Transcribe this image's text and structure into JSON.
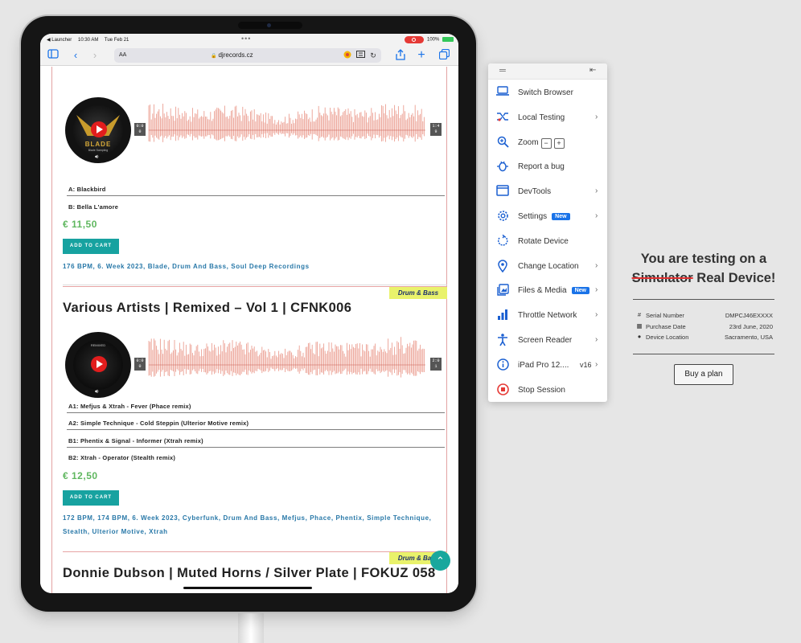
{
  "status_bar": {
    "back_app": "◀ Launcher",
    "time": "10:30 AM",
    "date": "Tue Feb 21",
    "battery": "100%"
  },
  "browser": {
    "text_size": "AA",
    "url": "djrecords.cz"
  },
  "page": {
    "product1": {
      "disc_text": "BLADE",
      "disc_sub": "Blade Sampling",
      "time_start": [
        "0:0",
        "0"
      ],
      "time_end": [
        "1:4",
        "9"
      ],
      "tracks": [
        "A: Blackbird",
        "B: Bella L'amore"
      ],
      "price": "€ 11,50",
      "cart_label": "ADD TO CART",
      "tags": "176 BPM, 6. Week 2023, Blade, Drum And Bass, Soul Deep Recordings"
    },
    "product2": {
      "genre": "Drum & Bass",
      "title": "Various Artists | Remixed – Vol 1 | CFNK006",
      "disc_top": "REMIXED",
      "time_start": [
        "0:0",
        "0"
      ],
      "time_end": [
        "2:0",
        "1"
      ],
      "tracks": [
        "A1: Mefjus & Xtrah - Fever (Phace remix)",
        "A2: Simple Technique - Cold Steppin (Ulterior Motive remix)",
        "B1: Phentix & Signal - Informer (Xtrah remix)",
        "B2: Xtrah - Operator (Stealth remix)"
      ],
      "price": "€ 12,50",
      "cart_label": "ADD TO CART",
      "tags": "172 BPM, 174 BPM, 6. Week 2023, Cyberfunk, Drum And Bass, Mefjus, Phace, Phentix, Simple Technique, Stealth, Ulterior Motive, Xtrah"
    },
    "product3": {
      "genre": "Drum & Bass",
      "title": "Donnie Dubson | Muted Horns / Silver Plate | FOKUZ 058"
    }
  },
  "menu": {
    "items": [
      {
        "label": "Switch Browser",
        "icon": "switch-browser-icon"
      },
      {
        "label": "Local Testing",
        "icon": "local-testing-icon"
      },
      {
        "label": "Zoom",
        "icon": "zoom-icon"
      },
      {
        "label": "Report a bug",
        "icon": "bug-icon"
      },
      {
        "label": "DevTools",
        "icon": "devtools-icon"
      },
      {
        "label": "Settings",
        "icon": "settings-icon",
        "badge": "New"
      },
      {
        "label": "Rotate Device",
        "icon": "rotate-icon"
      },
      {
        "label": "Change Location",
        "icon": "location-icon"
      },
      {
        "label": "Files & Media",
        "icon": "files-media-icon",
        "badge": "New"
      },
      {
        "label": "Throttle Network",
        "icon": "network-icon"
      },
      {
        "label": "Screen Reader",
        "icon": "screen-reader-icon"
      },
      {
        "label": "iPad Pro 12....",
        "icon": "info-icon",
        "version": "v16"
      },
      {
        "label": "Stop Session",
        "icon": "stop-icon"
      }
    ],
    "zoom_minus": "−",
    "zoom_plus": "+"
  },
  "info": {
    "line1": "You are testing on a",
    "struck": "Simulator",
    "line2_rest": "Real Device!",
    "rows": [
      {
        "label": "Serial Number",
        "value": "DMPCJ46EXXXX"
      },
      {
        "label": "Purchase Date",
        "value": "23rd June, 2020"
      },
      {
        "label": "Device Location",
        "value": "Sacramento, USA"
      }
    ],
    "buy_label": "Buy a plan"
  },
  "colors": {
    "accent": "#1a73e8",
    "price_green": "#5fb75f",
    "cart_teal": "#17a2a0",
    "tag_blue": "#2878a8",
    "genre_yellow": "#e9f26b",
    "wave_pink": "#e88f80"
  }
}
